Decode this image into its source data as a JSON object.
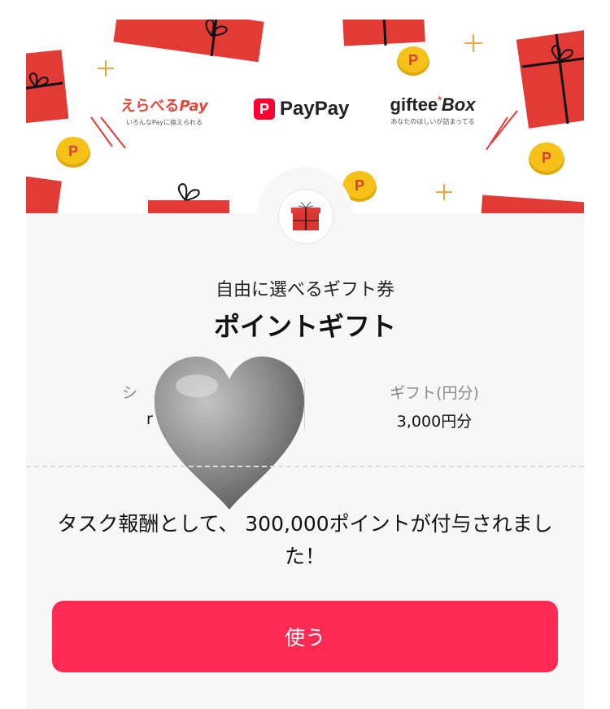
{
  "banner": {
    "erabel_pay": {
      "name": "えらべる",
      "pay": "Pay",
      "tagline": "いろんなPayに換えられる"
    },
    "paypay": {
      "mark": "P",
      "name": "PayPay"
    },
    "giftee_box": {
      "name": "giftee",
      "star": "*",
      "box": "Box",
      "tagline": "あなたのほしいが詰まってる"
    }
  },
  "gift": {
    "subtitle": "自由に選べるギフト券",
    "title": "ポイントギフト",
    "left_column": {
      "label": "シ",
      "value": "r"
    },
    "right_column": {
      "label": "ギフト(円分)",
      "value": "3,000円分"
    }
  },
  "message": "タスク報酬として、 300,000ポイントが付与されました！",
  "use_button_label": "使う",
  "colors": {
    "accent": "#fe2a54",
    "gift_red": "#e23a35",
    "coin": "#f6c21a",
    "card_bg": "#f7f7f7"
  },
  "icons": [
    "gift-box-icon",
    "coin-p-icon",
    "sparkle-icon",
    "heart-emoji-icon"
  ]
}
